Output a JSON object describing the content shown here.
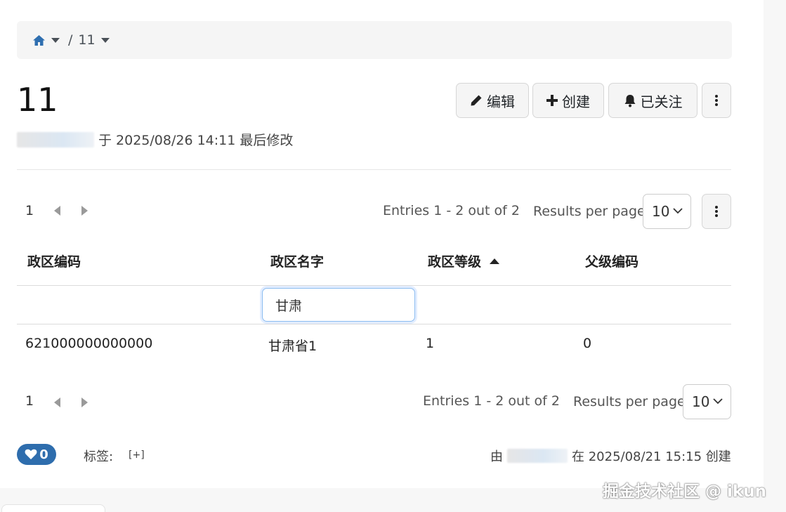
{
  "breadcrumb": {
    "current": "11"
  },
  "page": {
    "title": "11"
  },
  "toolbar": {
    "edit_label": "编辑",
    "create_label": "创建",
    "follow_label": "已关注"
  },
  "meta": {
    "modified_text": "于 2025/08/26 14:11 最后修改"
  },
  "pager_top": {
    "page": "1",
    "entries": "Entries 1 - 2 out of 2",
    "rpp_label": "Results per page:",
    "rpp_value": "10"
  },
  "table": {
    "columns": [
      "政区编码",
      "政区名字",
      "政区等级",
      "父级编码"
    ],
    "sorted_column": "政区等级",
    "filter_value": "甘肃",
    "rows": [
      {
        "code": "621000000000000",
        "name": "甘肃省1",
        "level": "1",
        "parent": "0"
      }
    ]
  },
  "pager_bottom": {
    "page": "1",
    "entries": "Entries 1 - 2 out of 2",
    "rpp_label": "Results per page:",
    "rpp_value": "10"
  },
  "footer": {
    "likes": "0",
    "tags_label": "标签:",
    "tags_add": "[+]",
    "created_prefix": "由",
    "created_suffix": "在 2025/08/21 15:15 创建"
  },
  "watermark": "掘金技术社区 @ ikun"
}
